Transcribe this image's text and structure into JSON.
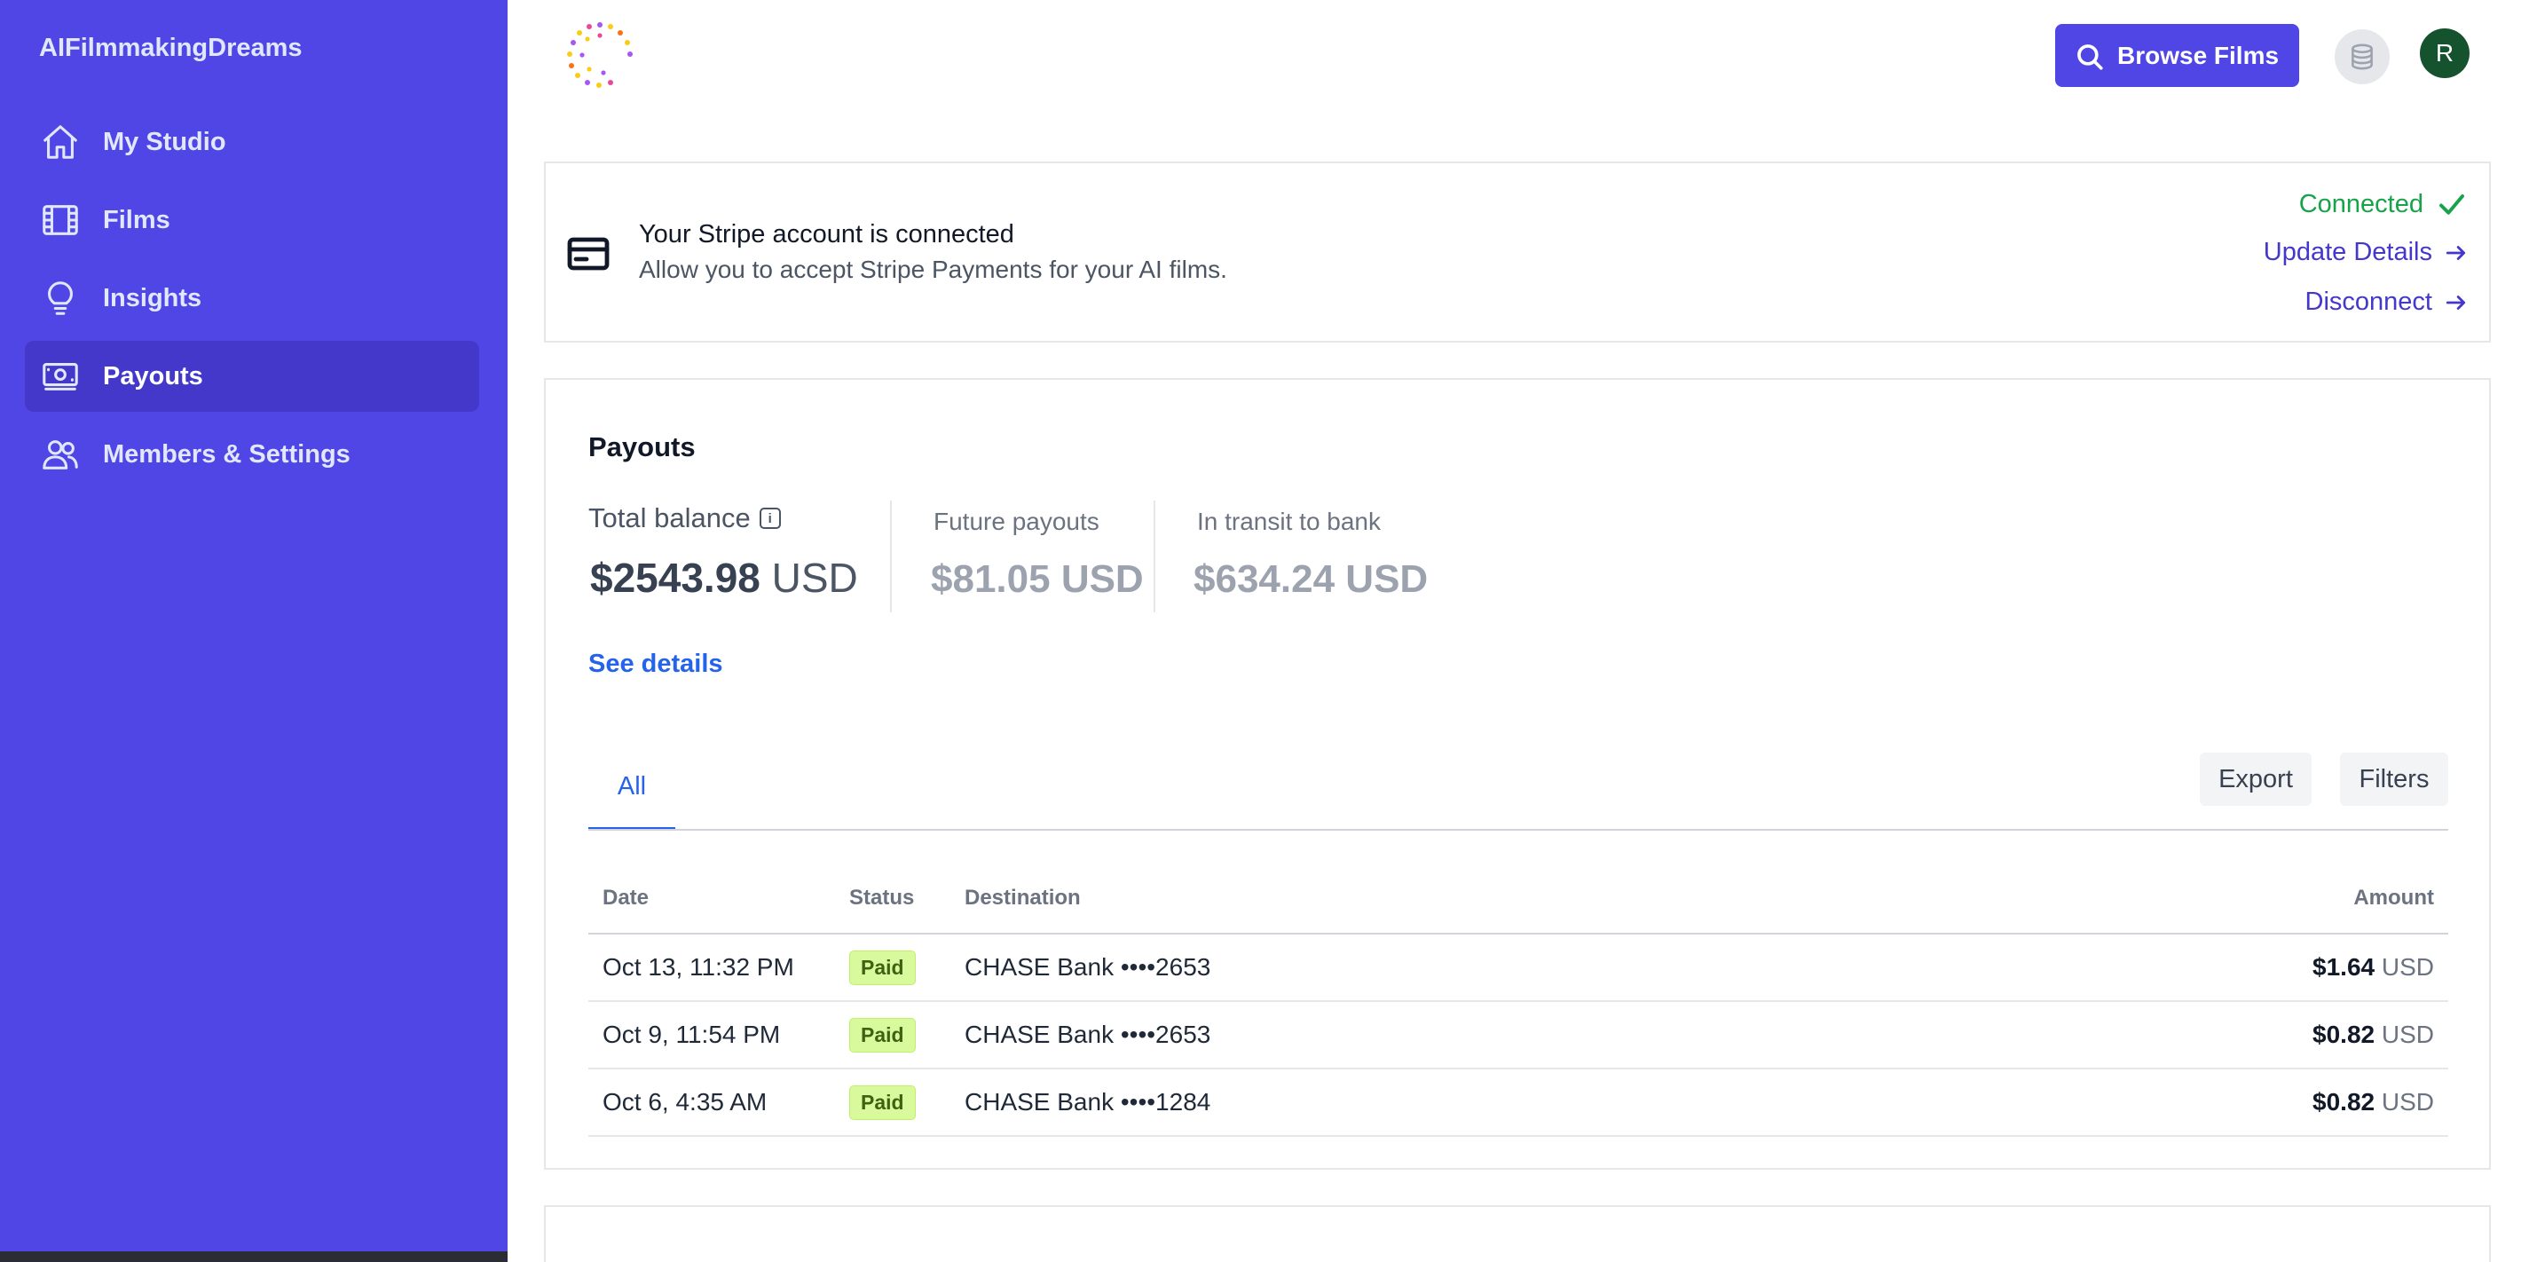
{
  "sidebar": {
    "brand": "AIFilmmakingDreams",
    "items": [
      {
        "label": "My Studio",
        "icon": "home-icon"
      },
      {
        "label": "Films",
        "icon": "film-icon"
      },
      {
        "label": "Insights",
        "icon": "lightbulb-icon"
      },
      {
        "label": "Payouts",
        "icon": "banknote-icon",
        "active": true
      },
      {
        "label": "Members & Settings",
        "icon": "users-icon"
      }
    ],
    "accent_color": "#4f46e5"
  },
  "header": {
    "browse_label": "Browse Films",
    "avatar_initial": "R"
  },
  "stripe": {
    "title": "Your Stripe account is connected",
    "subtitle": "Allow you to accept Stripe Payments for your AI films.",
    "status": "Connected",
    "update_label": "Update Details",
    "disconnect_label": "Disconnect"
  },
  "payouts": {
    "title": "Payouts",
    "total_label": "Total balance",
    "total_amount": "$2543.98",
    "total_currency": "USD",
    "future_label": "Future payouts",
    "future_amount": "$81.05",
    "future_currency": "USD",
    "transit_label": "In transit to bank",
    "transit_amount": "$634.24",
    "transit_currency": "USD",
    "see_details": "See details",
    "tab_all": "All",
    "export_label": "Export",
    "filters_label": "Filters",
    "columns": [
      "Date",
      "Status",
      "Destination",
      "Amount"
    ],
    "rows": [
      {
        "date": "Oct 13, 11:32 PM",
        "status": "Paid",
        "destination": "CHASE Bank ••••2653",
        "amount": "$1.64",
        "currency": "USD"
      },
      {
        "date": "Oct 9, 11:54 PM",
        "status": "Paid",
        "destination": "CHASE Bank ••••2653",
        "amount": "$0.82",
        "currency": "USD"
      },
      {
        "date": "Oct 6, 4:35 AM",
        "status": "Paid",
        "destination": "CHASE Bank ••••1284",
        "amount": "$0.82",
        "currency": "USD"
      }
    ]
  }
}
